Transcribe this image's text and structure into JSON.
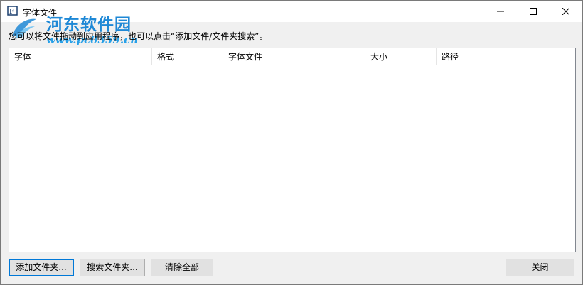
{
  "window": {
    "title": "字体文件",
    "controls": {
      "minimize": "minimize-icon",
      "maximize": "maximize-icon",
      "close": "close-icon"
    }
  },
  "watermark": {
    "text": "河东软件园",
    "url": "www.pc0359.cn"
  },
  "hint": "您可以将文件拖动到应用程序，也可以点击“添加文件/文件夹搜索”。",
  "table": {
    "columns": [
      "字体",
      "格式",
      "字体文件",
      "大小",
      "路径"
    ],
    "rows": []
  },
  "buttons": {
    "add_folder": "添加文件夹...",
    "search_folder": "搜索文件夹...",
    "clear_all": "清除全部",
    "close": "关闭"
  },
  "colors": {
    "accent": "#0078d7",
    "watermark": "#1e88d6"
  }
}
